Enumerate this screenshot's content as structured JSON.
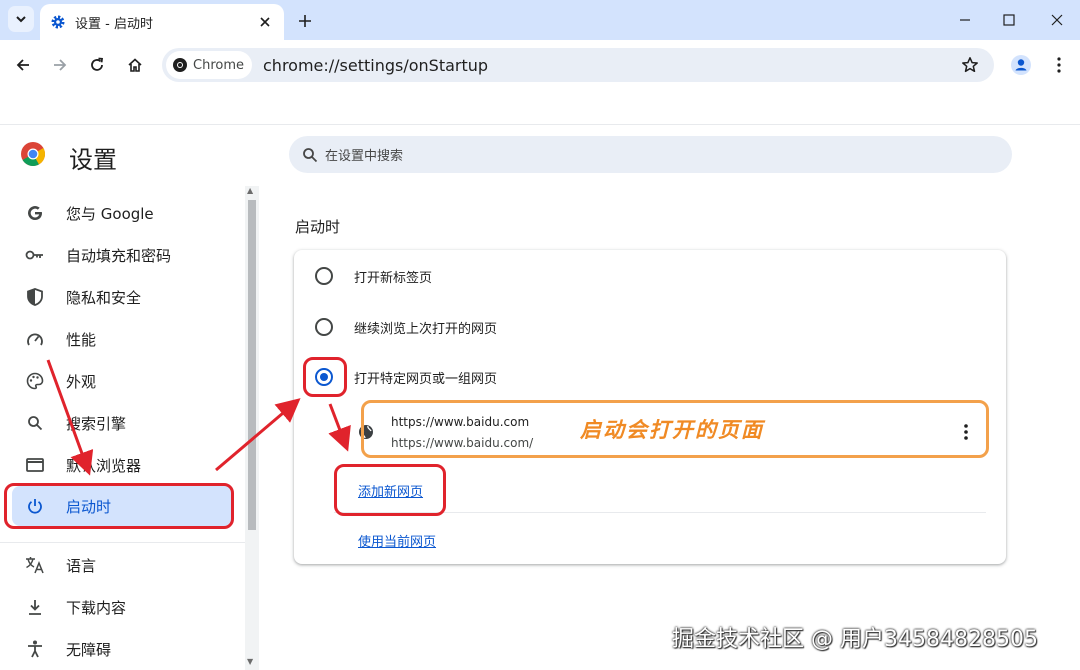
{
  "browser": {
    "tab_title": "设置 - 启动时",
    "chip_label": "Chrome",
    "url": "chrome://settings/onStartup"
  },
  "settings": {
    "title": "设置",
    "search_placeholder": "在设置中搜索"
  },
  "sidebar": {
    "items": [
      {
        "label": "您与 Google",
        "icon": "google-g-icon"
      },
      {
        "label": "自动填充和密码",
        "icon": "key-icon"
      },
      {
        "label": "隐私和安全",
        "icon": "shield-icon"
      },
      {
        "label": "性能",
        "icon": "speedometer-icon"
      },
      {
        "label": "外观",
        "icon": "palette-icon"
      },
      {
        "label": "搜索引擎",
        "icon": "search-icon"
      },
      {
        "label": "默认浏览器",
        "icon": "browser-window-icon"
      },
      {
        "label": "启动时",
        "icon": "power-icon",
        "active": true
      },
      {
        "label": "语言",
        "icon": "translate-icon"
      },
      {
        "label": "下载内容",
        "icon": "download-icon"
      },
      {
        "label": "无障碍",
        "icon": "accessibility-icon"
      }
    ]
  },
  "startup": {
    "section_title": "启动时",
    "options": [
      {
        "label": "打开新标签页",
        "selected": false
      },
      {
        "label": "继续浏览上次打开的网页",
        "selected": false
      },
      {
        "label": "打开特定网页或一组网页",
        "selected": true
      }
    ],
    "pages": [
      {
        "title": "https://www.baidu.com",
        "url": "https://www.baidu.com/"
      }
    ],
    "add_page_label": "添加新网页",
    "use_current_label": "使用当前网页"
  },
  "annotation": {
    "callout_text": "启动会打开的页面",
    "watermark": "掘金技术社区 @ 用户34584828505"
  },
  "colors": {
    "accent": "#0b57d0",
    "tabstrip": "#d3e3fd",
    "annotation_red": "#e0232c",
    "annotation_orange": "#f3a14b"
  }
}
